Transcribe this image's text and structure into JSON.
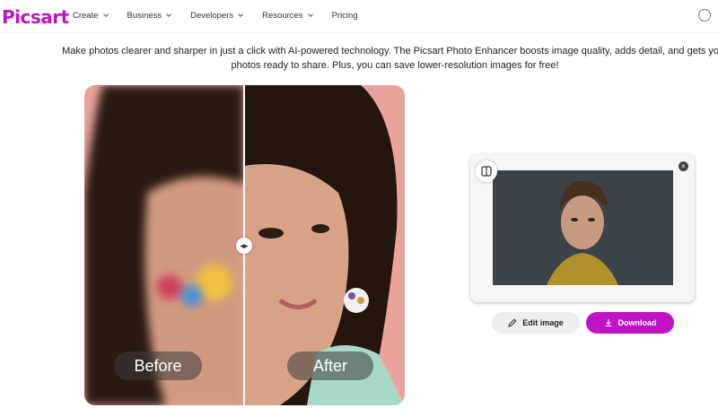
{
  "brand": {
    "name": "Picsart",
    "color": "#c013c6"
  },
  "nav": {
    "items": [
      {
        "label": "Create",
        "has_dropdown": true
      },
      {
        "label": "Business",
        "has_dropdown": true
      },
      {
        "label": "Developers",
        "has_dropdown": true
      },
      {
        "label": "Resources",
        "has_dropdown": true
      },
      {
        "label": "Pricing",
        "has_dropdown": false
      }
    ]
  },
  "hero": {
    "description_line1": "Make photos clearer and sharper in just a click with AI-powered technology. The Picsart Photo Enhancer boosts image quality, adds detail, and gets your",
    "description_line2": "photos ready to share. Plus, you can save lower-resolution images for free!"
  },
  "comparison": {
    "before_label": "Before",
    "after_label": "After",
    "handle_glyph": "◂▸",
    "background_color": "#e8a49c"
  },
  "result_card": {
    "close_glyph": "×",
    "edit_button_label": "Edit image",
    "download_button_label": "Download"
  }
}
